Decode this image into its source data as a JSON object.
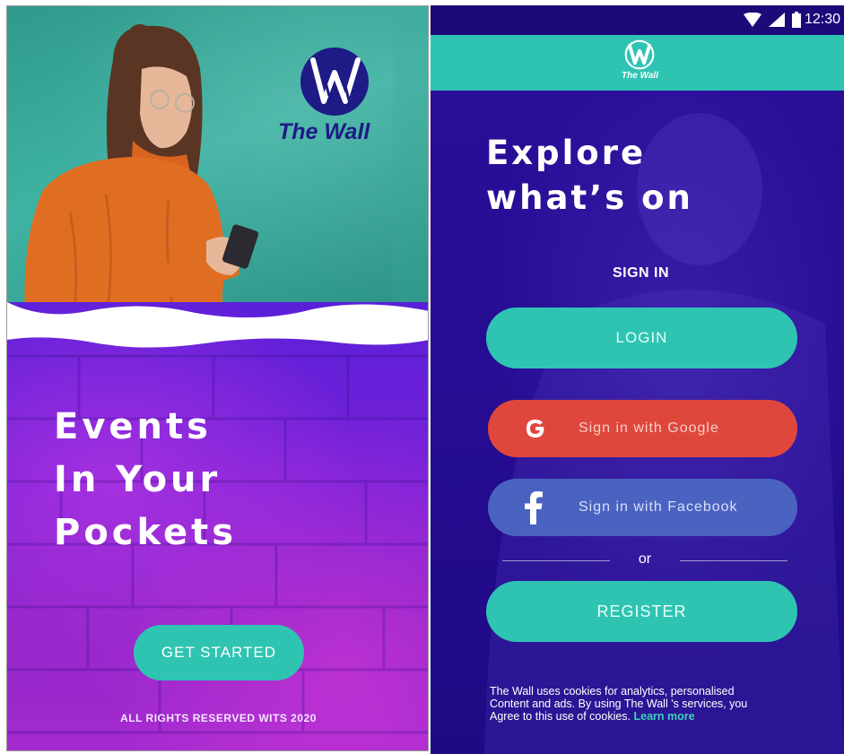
{
  "left_screen": {
    "brand": {
      "name": "The Wall"
    },
    "headline": [
      "Events",
      "In Your",
      "Pockets"
    ],
    "get_started_label": "GET STARTED",
    "rights_text": "ALL RIGHTS RESERVED WITS 2020"
  },
  "right_screen": {
    "status_bar": {
      "time": "12:30",
      "icons": [
        "wifi-icon",
        "signal-icon",
        "battery-icon"
      ]
    },
    "app_bar": {
      "brand_name": "The Wall"
    },
    "headline": [
      "Explore",
      "what’s on"
    ],
    "signin_label": "SIGN IN",
    "login_label": "LOGIN",
    "google_label": "Sign in with Google",
    "facebook_label": "Sign in with Facebook",
    "or_label": "or",
    "register_label": "REGISTER",
    "cookie_notice": {
      "lines": [
        "The Wall uses cookies for analytics, personalised",
        "Content and ads. By using The Wall 's services, you",
        "Agree to this use of cookies. "
      ],
      "learn_more": "Learn more"
    }
  },
  "colors": {
    "teal_accent": "#2fc4b2",
    "google_red": "#e0473c",
    "facebook_blue": "#4b63c0",
    "brand_navy": "#1e1a86",
    "deep_purple": "#260c92"
  }
}
